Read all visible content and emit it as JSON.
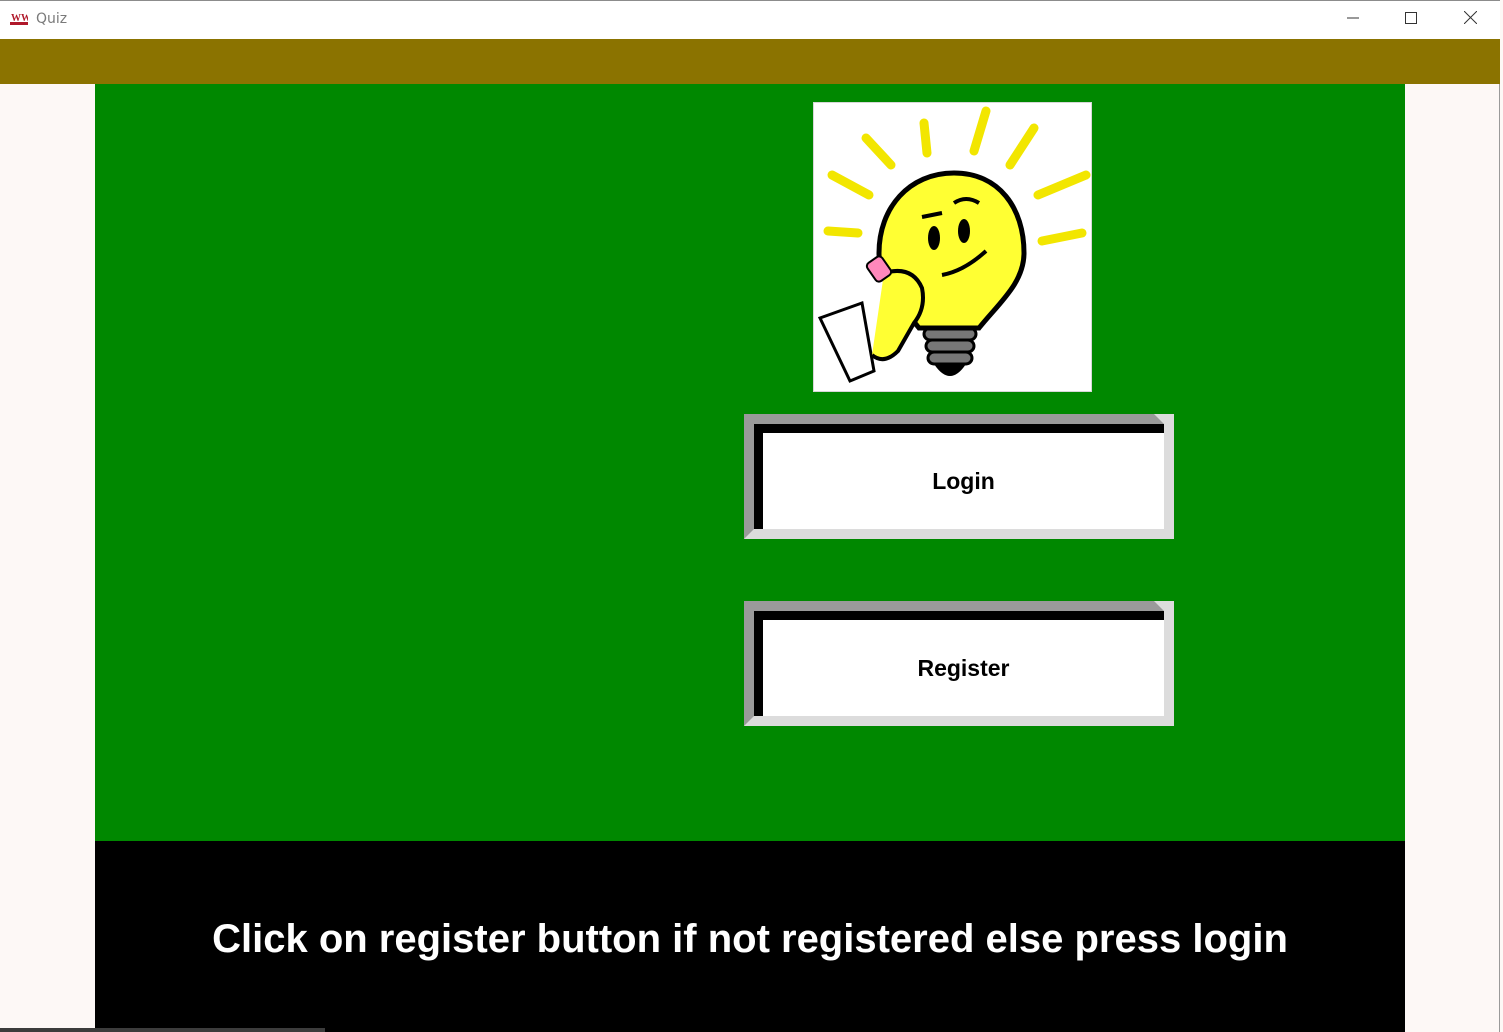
{
  "window": {
    "title": "Quiz"
  },
  "titlebar_icons": {
    "app": "quiz-app-icon",
    "minimize": "minimize-icon",
    "maximize": "maximize-icon",
    "close": "close-icon"
  },
  "colors": {
    "menubar": "#8b7300",
    "content_bg": "#008800",
    "footer_bg": "#000000",
    "footer_text": "#ffffff",
    "button_face": "#ffffff"
  },
  "logo": {
    "icon": "lightbulb-thinking-icon"
  },
  "buttons": {
    "login_label": "Login",
    "register_label": "Register"
  },
  "footer": {
    "message": "Click on register button if not registered else press login"
  }
}
